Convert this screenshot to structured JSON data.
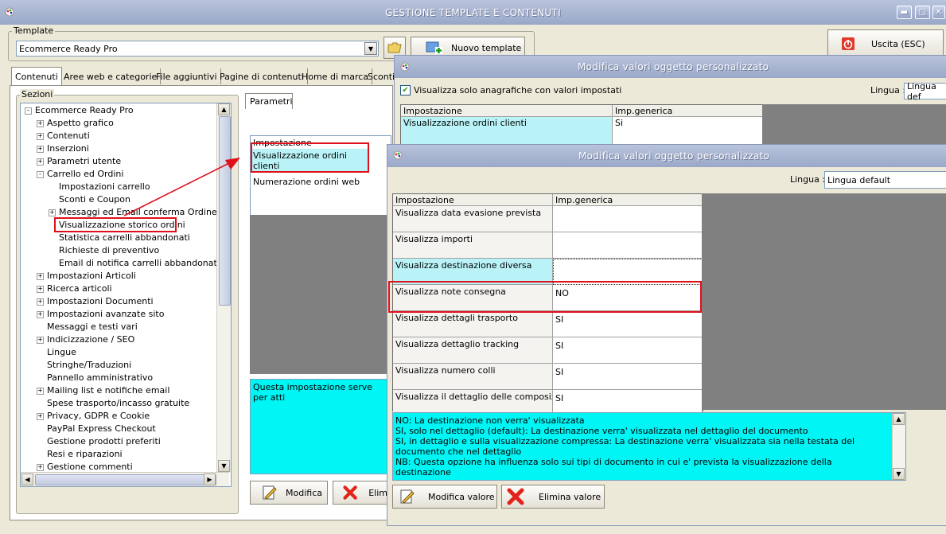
{
  "main_window": {
    "title": "GESTIONE TEMPLATE E CONTENUTI",
    "template_label": "Template",
    "template_value": "Ecommerce Ready Pro",
    "new_template_label": "Nuovo template",
    "exit_label": "Uscita (ESC)",
    "tabs": [
      "Contenuti",
      "Aree web e categorie",
      "File aggiuntivi",
      "Pagine di contenuti",
      "Home di marca",
      "Sconti"
    ],
    "sections_label": "Sezioni",
    "tree": {
      "root": "Ecommerce Ready Pro",
      "items": [
        {
          "label": "Aspetto grafico",
          "level": 1,
          "expander": "+"
        },
        {
          "label": "Contenuti",
          "level": 1,
          "expander": "+"
        },
        {
          "label": "Inserzioni",
          "level": 1,
          "expander": "+"
        },
        {
          "label": "Parametri utente",
          "level": 1,
          "expander": "+"
        },
        {
          "label": "Carrello ed Ordini",
          "level": 1,
          "expander": "-"
        },
        {
          "label": "Impostazioni carrello",
          "level": 2,
          "expander": ""
        },
        {
          "label": "Sconti e Coupon",
          "level": 2,
          "expander": ""
        },
        {
          "label": "Messaggi ed Email conferma Ordine",
          "level": 2,
          "expander": "+"
        },
        {
          "label": "Visualizzazione storico ordini",
          "level": 2,
          "expander": ""
        },
        {
          "label": "Statistica carrelli abbandonati",
          "level": 2,
          "expander": ""
        },
        {
          "label": "Richieste di preventivo",
          "level": 2,
          "expander": ""
        },
        {
          "label": "Email di notifica carrelli abbandonati",
          "level": 2,
          "expander": ""
        },
        {
          "label": "Impostazioni Articoli",
          "level": 1,
          "expander": "+"
        },
        {
          "label": "Ricerca articoli",
          "level": 1,
          "expander": "+"
        },
        {
          "label": "Impostazioni Documenti",
          "level": 1,
          "expander": "+"
        },
        {
          "label": "Impostazioni avanzate sito",
          "level": 1,
          "expander": "+"
        },
        {
          "label": "Messaggi e testi vari",
          "level": 1,
          "expander": ""
        },
        {
          "label": "Indicizzazione / SEO",
          "level": 1,
          "expander": "+"
        },
        {
          "label": "Lingue",
          "level": 1,
          "expander": ""
        },
        {
          "label": "Stringhe/Traduzioni",
          "level": 1,
          "expander": ""
        },
        {
          "label": "Pannello amministrativo",
          "level": 1,
          "expander": ""
        },
        {
          "label": "Mailing list e notifiche email",
          "level": 1,
          "expander": "+"
        },
        {
          "label": "Spese trasporto/incasso gratuite",
          "level": 1,
          "expander": ""
        },
        {
          "label": "Privacy, GDPR e Cookie",
          "level": 1,
          "expander": "+"
        },
        {
          "label": "PayPal Express Checkout",
          "level": 1,
          "expander": ""
        },
        {
          "label": "Gestione prodotti preferiti",
          "level": 1,
          "expander": ""
        },
        {
          "label": "Resi e riparazioni",
          "level": 1,
          "expander": ""
        },
        {
          "label": "Gestione commenti",
          "level": 1,
          "expander": "+"
        }
      ]
    },
    "params_tab": "Parametri",
    "params_header": "Impostazione",
    "params_rows": [
      "Visualizzazione ordini clienti",
      "Numerazione ordini web"
    ],
    "params_desc": "Questa impostazione serve per atti",
    "modify_label": "Modifica",
    "delete_label_partial": "Elim"
  },
  "dialog1": {
    "title": "Modifica valori oggetto personalizzato",
    "checkbox_label": "Visualizza solo anagrafiche con valori impostati",
    "language_label": "Lingua :",
    "language_value": "Lingua def",
    "col_setting": "Impostazione",
    "col_generic": "Imp.generica",
    "rows": [
      {
        "setting": "Visualizzazione ordini clienti",
        "value": "Si"
      }
    ]
  },
  "dialog2": {
    "title": "Modifica valori oggetto personalizzato",
    "language_label": "Lingua :",
    "language_value": "Lingua default",
    "col_setting": "Impostazione",
    "col_generic": "Imp.generica",
    "rows": [
      {
        "setting": "Visualizza data evasione prevista",
        "value": ""
      },
      {
        "setting": "Visualizza importi",
        "value": ""
      },
      {
        "setting": "Visualizza destinazione diversa",
        "value": ""
      },
      {
        "setting": "Visualizza note consegna",
        "value": "NO"
      },
      {
        "setting": "Visualizza dettagli trasporto",
        "value": "SI"
      },
      {
        "setting": "Visualizza dettaglio tracking",
        "value": "SI"
      },
      {
        "setting": "Visualizza numero colli",
        "value": "SI"
      },
      {
        "setting": "Visualizza il dettaglio delle composizioni",
        "value": "SI"
      }
    ],
    "desc_lines": [
      "NO: La destinazione non verra' visualizzata",
      "SI, solo nel dettaglio  (default): La destinazione verra' visualizzata nel dettaglio del documento",
      "SI, in dettaglio e sulla visualizzazione compressa: La destinazione verra' visualizzata sia nella testata del documento che nel dettaglio",
      "NB: Questa opzione ha influenza solo sui tipi di documento in cui e' prevista la visualizzazione della destinazione"
    ],
    "modify_value_label": "Modifica valore",
    "delete_value_label": "Elimina valore"
  },
  "colors": {
    "highlight_red": "#e0101b",
    "desc_cyan": "#00f5f5",
    "selected_cell": "#b9f3f7"
  }
}
